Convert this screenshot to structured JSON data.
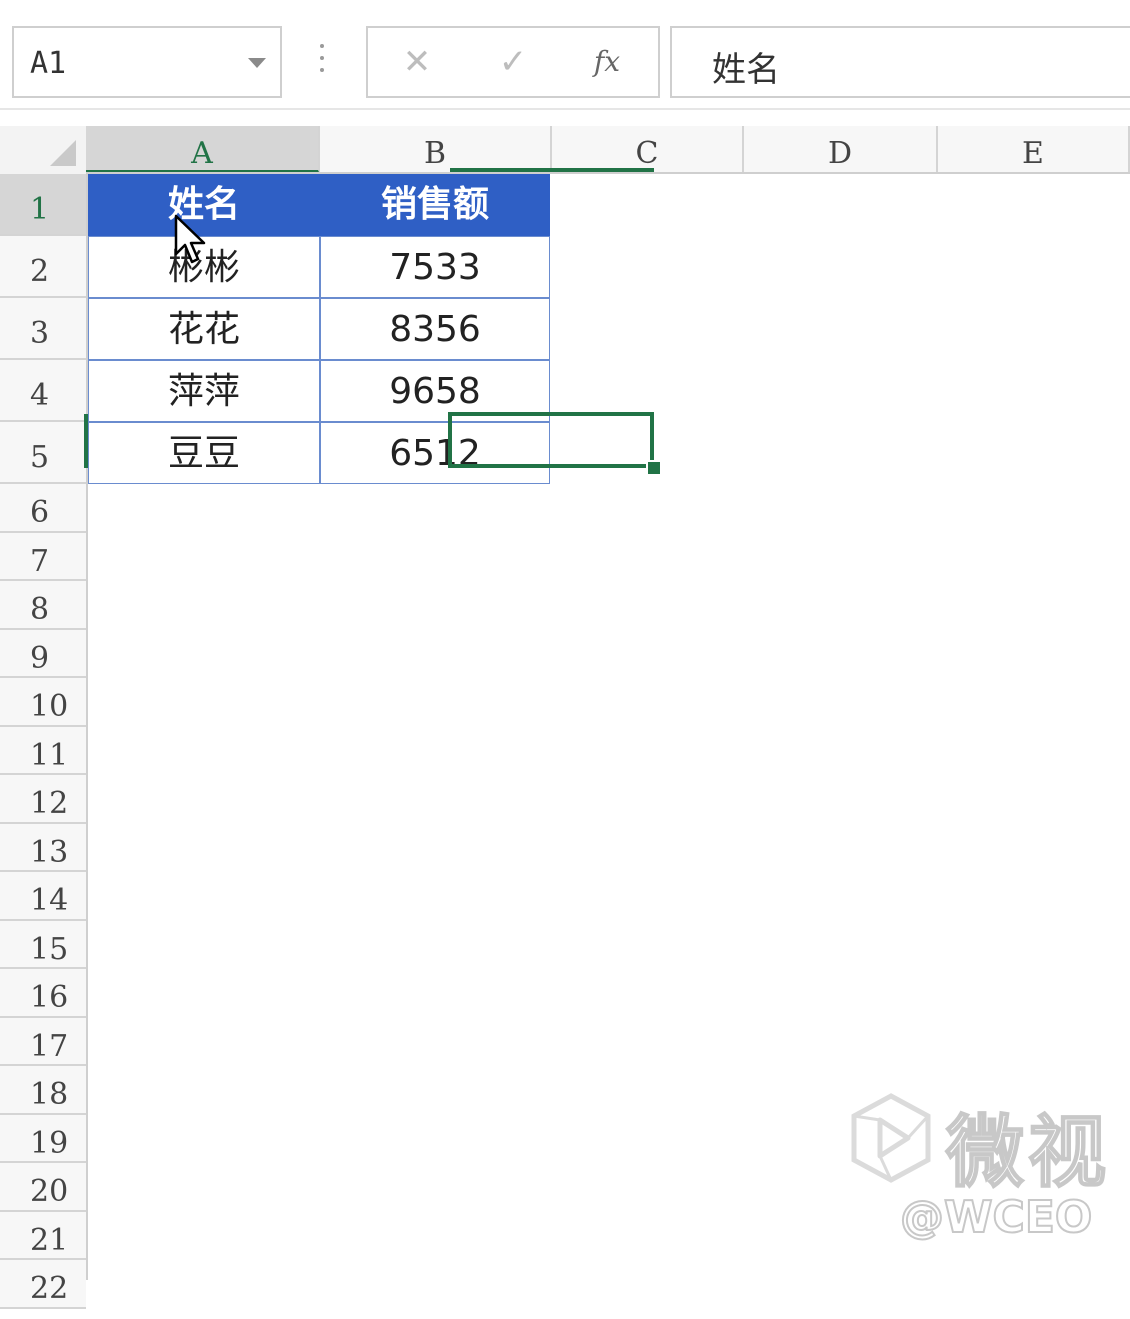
{
  "formula_bar": {
    "name_box": "A1",
    "cancel_icon": "✕",
    "enter_icon": "✓",
    "fx_label": "fx",
    "content": "姓名"
  },
  "columns": [
    "A",
    "B",
    "C",
    "D",
    "E"
  ],
  "rows": [
    "1",
    "2",
    "3",
    "4",
    "5",
    "6",
    "7",
    "8",
    "9",
    "10",
    "11",
    "12",
    "13",
    "14",
    "15",
    "16",
    "17",
    "18",
    "19",
    "20",
    "21",
    "22"
  ],
  "table": {
    "headers": [
      "姓名",
      "销售额"
    ],
    "rows": [
      [
        "彬彬",
        "7533"
      ],
      [
        "花花",
        "8356"
      ],
      [
        "萍萍",
        "9658"
      ],
      [
        "豆豆",
        "6512"
      ]
    ]
  },
  "watermark": {
    "brand": "微视",
    "account": "@WCEO"
  },
  "colors": {
    "header_fill": "#2f5fc5",
    "selection": "#217346"
  }
}
